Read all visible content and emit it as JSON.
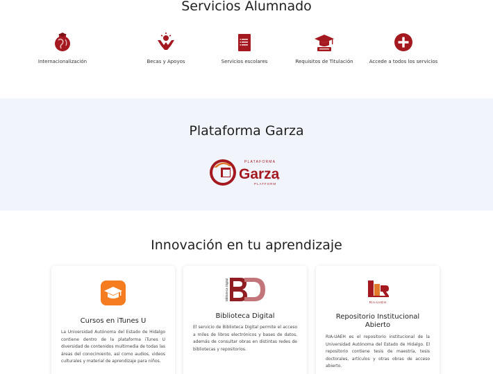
{
  "servicios": {
    "title": "Servicios Alumnado",
    "items": [
      {
        "label": "Internacionalización",
        "icon": "globe-icon"
      },
      {
        "label": "Becas y Apoyos",
        "icon": "hands-heart-icon"
      },
      {
        "label": "Servicios escolares",
        "icon": "document-list-icon"
      },
      {
        "label": "Requisitos de Titulación",
        "icon": "graduation-cap-icon"
      },
      {
        "label": "Accede a todos los servicios",
        "icon": "plus-circle-icon"
      }
    ]
  },
  "plataforma": {
    "title": "Plataforma Garza",
    "logo_word": "Garza",
    "logo_top": "PLATAFORMA",
    "logo_bottom": "PLATFORM",
    "logo_mark": "®"
  },
  "innovacion": {
    "title": "Innovación en tu aprendizaje",
    "cards": [
      {
        "title": "Cursos en iTunes U",
        "icon": "itunes-u-icon",
        "description": "La Universidad Autónoma del Estado de Hidalgo contiene dentro de la plataforma iTunes U diversidad de contenidos multimedia de todas las áreas del conocimiento, así como audios, videos culturales y material de aprendizaje para niños."
      },
      {
        "title": "Biblioteca Digital",
        "icon": "biblioteca-digital-logo",
        "logo_vertical_text": "Biblioteca Digital",
        "description": "El servicio de Biblioteca Digital permite el acceso a miles de libros electrónicos y bases de datos, además de consultar obras en distintas redes de bibliotecas y repositorios."
      },
      {
        "title": "Repositorio Institucional Abierto",
        "icon": "ria-logo",
        "logo_caption": "RIA-UAEH",
        "description": "RIA-UAEH es el repositorio institucional de la Universidad Autónoma del Estado de Hidalgo. El repositorio contiene tesis de maestría, tesis doctorales, artículos y otras obras de acceso abierto."
      }
    ]
  },
  "colors": {
    "brand_red": "#a3191f",
    "itunes_orange": "#f57c1f",
    "band_bg": "#f1f5fb"
  }
}
